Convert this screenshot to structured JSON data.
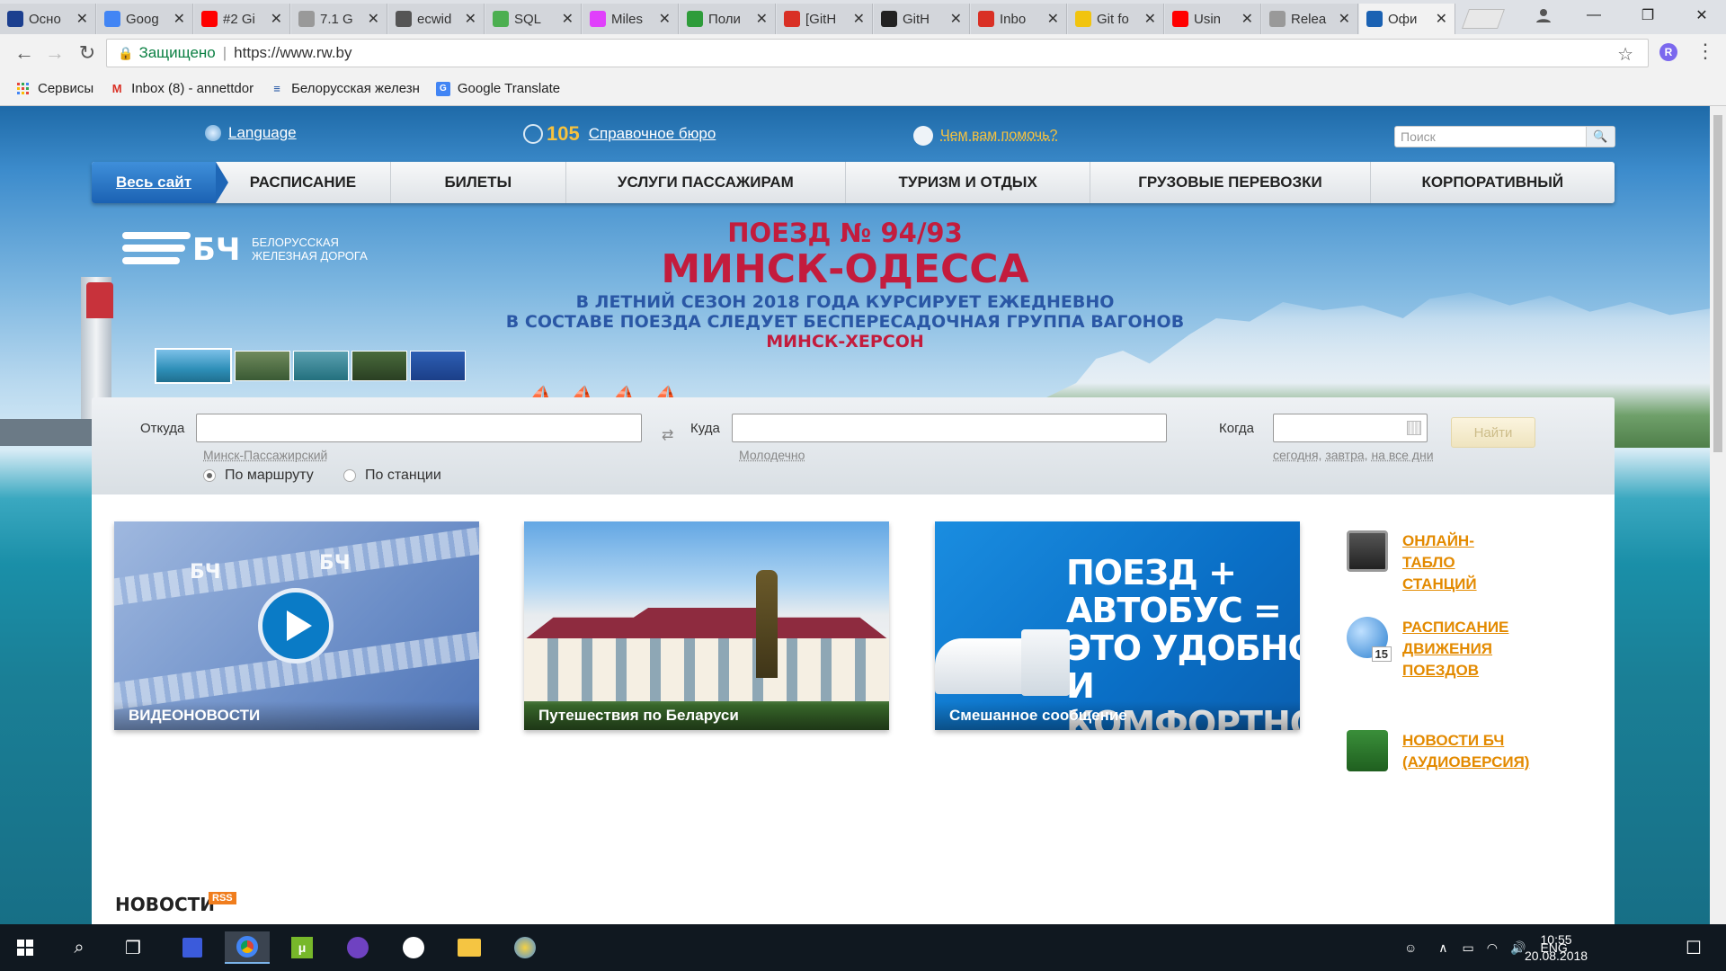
{
  "browser": {
    "tabs": [
      {
        "label": "Осно",
        "icon": "m-icon",
        "color": "#1c3f8f"
      },
      {
        "label": "Goog",
        "icon": "google-translate-icon",
        "color": "#4285f4"
      },
      {
        "label": "#2 Gi",
        "icon": "youtube-icon",
        "color": "#ff0000"
      },
      {
        "label": "7.1 G",
        "icon": "document-icon",
        "color": "#999999"
      },
      {
        "label": "ecwid",
        "icon": "pb-icon",
        "color": "#555555"
      },
      {
        "label": "SQL",
        "icon": "sql-icon",
        "color": "#4caf50"
      },
      {
        "label": "Miles",
        "icon": "miles-icon",
        "color": "#e040fb"
      },
      {
        "label": "Поли",
        "icon": "plus-icon",
        "color": "#2e9c3a"
      },
      {
        "label": "[GitH",
        "icon": "gmail-icon",
        "color": "#d93025"
      },
      {
        "label": "GitH",
        "icon": "github-icon",
        "color": "#222222"
      },
      {
        "label": "Inbo",
        "icon": "gmail-icon",
        "color": "#d93025"
      },
      {
        "label": "Git fo",
        "icon": "git-icon",
        "color": "#f1c40f"
      },
      {
        "label": "Usin",
        "icon": "youtube-icon",
        "color": "#ff0000"
      },
      {
        "label": "Relea",
        "icon": "document-icon",
        "color": "#999999"
      },
      {
        "label": "Офи",
        "icon": "rw-icon",
        "color": "#1b62b3",
        "active": true
      }
    ],
    "secure_label": "Защищено",
    "url": "https://www.rw.by",
    "extension_badge": "R",
    "bookmarks": [
      {
        "label": "Сервисы",
        "icon": "apps-grid-icon"
      },
      {
        "label": "Inbox (8) - annettdor",
        "icon": "gmail-icon"
      },
      {
        "label": "Белорусская железн",
        "icon": "rw-icon"
      },
      {
        "label": "Google Translate",
        "icon": "google-translate-icon"
      }
    ]
  },
  "site": {
    "header": {
      "language": "Language",
      "phone_number": "105",
      "phone_label": "Справочное бюро",
      "help_label": "Чем вам помочь?",
      "search_placeholder": "Поиск"
    },
    "nav": {
      "all_site": "Весь сайт",
      "items": [
        "РАСПИСАНИЕ",
        "БИЛЕТЫ",
        "УСЛУГИ ПАССАЖИРАМ",
        "ТУРИЗМ И ОТДЫХ",
        "ГРУЗОВЫЕ ПЕРЕВОЗКИ",
        "КОРПОРАТИВНЫЙ"
      ]
    },
    "logo": {
      "mark": "БЧ",
      "line1": "Белорусская",
      "line2": "железная дорога"
    },
    "banner": {
      "line1": "ПОЕЗД № 94/93",
      "line2": "МИНСК-ОДЕССА",
      "line3": "В ЛЕТНИЙ СЕЗОН 2018 ГОДА КУРСИРУЕТ ЕЖЕДНЕВНО",
      "line4": "В СОСТАВЕ ПОЕЗДА СЛЕДУЕТ БЕСПЕРЕСАДОЧНАЯ ГРУППА ВАГОНОВ",
      "line5": "МИНСК-ХЕРСОН",
      "thumbnail_count": 5,
      "active_thumbnail": 1
    },
    "search_form": {
      "from_label": "Откуда",
      "from_hint": "Минск-Пассажирский",
      "to_label": "Куда",
      "to_hint": "Молодечно",
      "when_label": "Когда",
      "when_hint_today": "сегодня",
      "when_hint_tomorrow": "завтра",
      "when_hint_all": "на все дни",
      "find_button": "Найти",
      "radio_route": "По маршруту",
      "radio_station": "По станции"
    },
    "cards": [
      {
        "caption": "ВИДЕОНОВОСТИ",
        "watermark": "БЧ"
      },
      {
        "caption": "Путешествия по Беларуси"
      },
      {
        "caption": "Смешанное сообщение",
        "promo": "ПОЕЗД +\nАВТОБУС =\nЭТО УДОБНО\nИ КОМФОРТНО!"
      }
    ],
    "side_links": [
      {
        "label": "ОНЛАЙН-\nТАБЛО\nСТАНЦИЙ",
        "icon": "board-icon"
      },
      {
        "label": "РАСПИСАНИЕ\nДВИЖЕНИЯ\nПОЕЗДОВ",
        "icon": "calendar-icon",
        "badge": "15"
      },
      {
        "label": "НОВОСТИ БЧ\n(АУДИОВЕРСИЯ)",
        "icon": "microphone-icon"
      }
    ],
    "news": {
      "heading": "НОВОСТИ",
      "rss": "RSS"
    }
  },
  "taskbar": {
    "language": "ENG",
    "time": "10:55",
    "date": "20.08.2018"
  }
}
